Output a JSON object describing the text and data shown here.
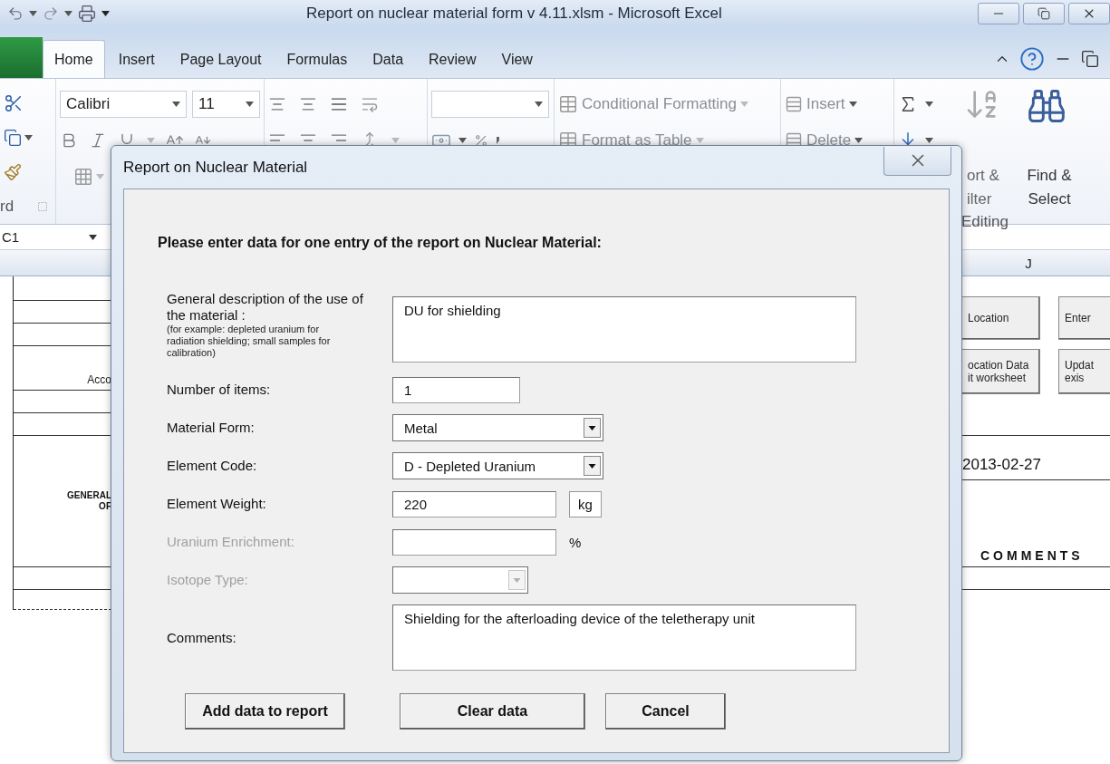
{
  "window": {
    "title": "Report on nuclear material form v 4.11.xlsm  -  Microsoft Excel"
  },
  "ribbon": {
    "tabs": [
      {
        "label": "Home",
        "selected": true
      },
      {
        "label": "Insert",
        "selected": false
      },
      {
        "label": "Page Layout",
        "selected": false
      },
      {
        "label": "Formulas",
        "selected": false
      },
      {
        "label": "Data",
        "selected": false
      },
      {
        "label": "Review",
        "selected": false
      },
      {
        "label": "View",
        "selected": false
      }
    ],
    "font_name": "Calibri",
    "font_size": "11",
    "clipboard_label": "rd",
    "styles": [
      "Conditional Formatting",
      "Format as Table"
    ],
    "cells": [
      "Insert",
      "Delete"
    ],
    "sort_lines": [
      "ort &",
      "ilter"
    ],
    "find_lines": [
      "Find &",
      "Select"
    ],
    "editing_label": "Editing"
  },
  "name_box": "C1",
  "sheet": {
    "column_header": "J",
    "cell_text": "Acco",
    "heading_lines": [
      "GENERAL",
      "OF"
    ],
    "buttons": [
      {
        "lines": [
          "Location"
        ]
      },
      {
        "lines": [
          "Enter"
        ]
      },
      {
        "lines": [
          "ocation Data",
          "it worksheet"
        ]
      },
      {
        "lines": [
          "Updat",
          "exis"
        ]
      }
    ],
    "date": "2013-02-27",
    "comments_heading": "COMMENTS"
  },
  "dialog": {
    "title": "Report on Nuclear Material",
    "heading": "Please enter data for one entry of the report on Nuclear Material:",
    "fields": [
      {
        "kind": "textarea",
        "label": "General description of the use of the material :",
        "hint": "(for example: depleted uranium for radiation shielding; small samples for calibration)",
        "value": "DU for shielding",
        "disabled": false
      },
      {
        "kind": "text",
        "label": "Number of items:",
        "value": "1",
        "disabled": false
      },
      {
        "kind": "select",
        "label": "Material Form:",
        "value": "Metal",
        "disabled": false
      },
      {
        "kind": "select",
        "label": "Element Code:",
        "value": "D - Depleted Uranium",
        "disabled": false
      },
      {
        "kind": "text",
        "label": "Element Weight:",
        "value": "220",
        "unit": "kg",
        "unit_framed": true,
        "disabled": false
      },
      {
        "kind": "text",
        "label": "Uranium Enrichment:",
        "unit": "%",
        "unit_framed": false,
        "disabled": true
      },
      {
        "kind": "select",
        "label": "Isotope Type:",
        "disabled": true
      },
      {
        "kind": "comments",
        "label": "Comments:",
        "value": "Shielding for the afterloading device of the teletherapy unit",
        "disabled": false
      }
    ],
    "buttons": [
      "Add data to report",
      "Clear data",
      "Cancel"
    ]
  }
}
